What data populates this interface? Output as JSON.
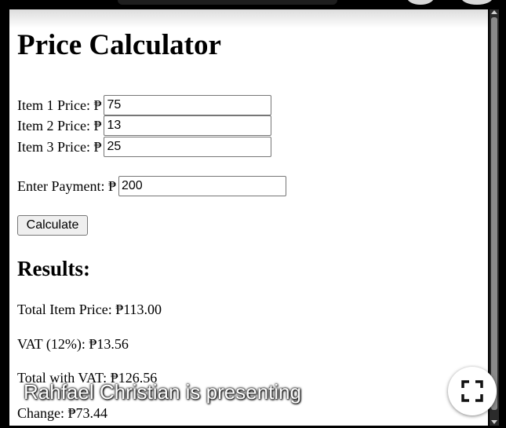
{
  "page": {
    "title": "Price Calculator",
    "currency_symbol": "₱",
    "items": [
      {
        "label": "Item 1 Price: ₱",
        "value": "75"
      },
      {
        "label": "Item 2 Price: ₱",
        "value": "13"
      },
      {
        "label": "Item 3 Price: ₱",
        "value": "25"
      }
    ],
    "payment": {
      "label": "Enter Payment: ₱",
      "value": "200"
    },
    "calculate_label": "Calculate",
    "results_heading": "Results:",
    "results": {
      "total_item_price": "Total Item Price: ₱113.00",
      "vat": "VAT (12%): ₱13.56",
      "total_with_vat": "Total with VAT: ₱126.56",
      "change": "Change: ₱73.44"
    }
  },
  "overlay": {
    "presenting_text": "Rahfael Christian is presenting",
    "fullscreen_icon": "fullscreen-icon"
  }
}
